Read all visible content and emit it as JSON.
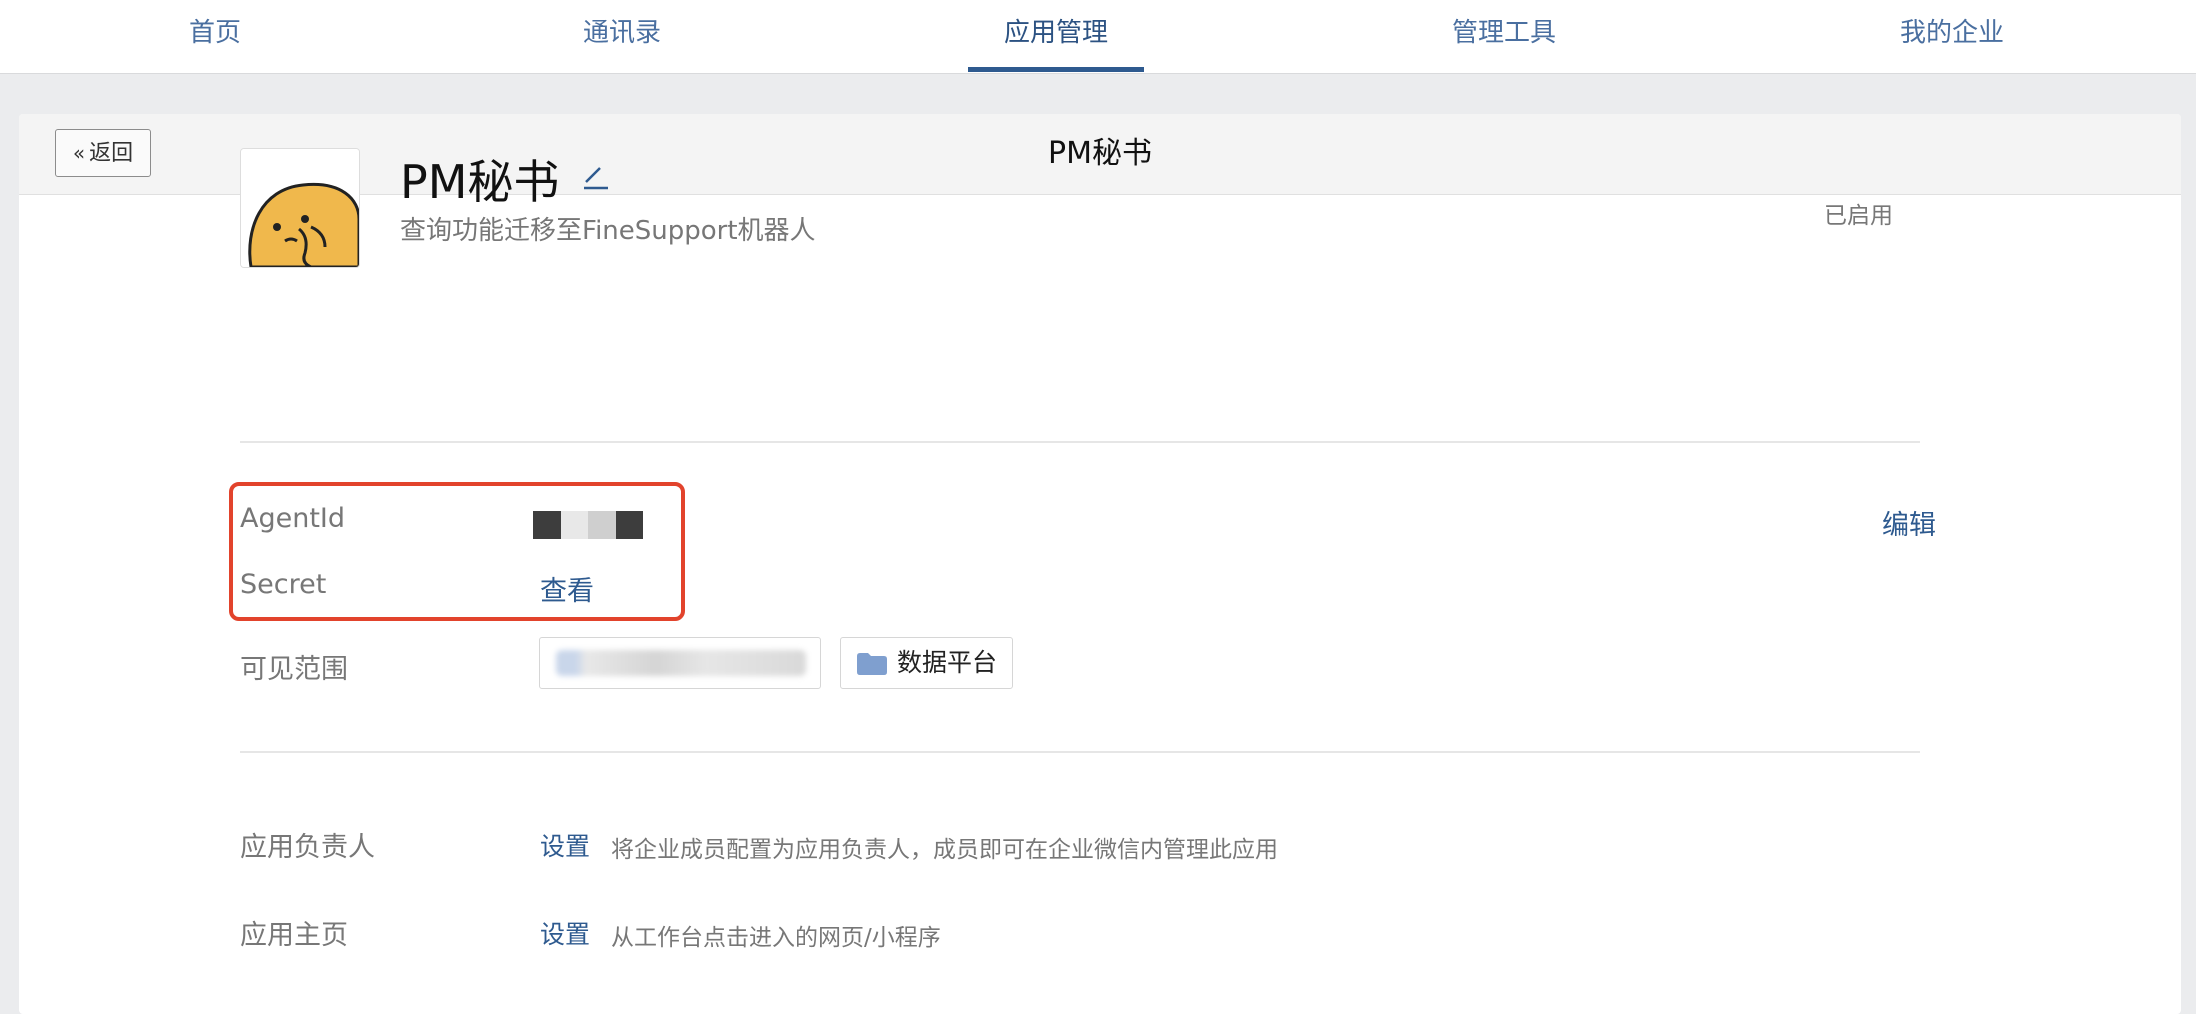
{
  "nav": {
    "items": [
      "首页",
      "通讯录",
      "应用管理",
      "管理工具",
      "我的企业"
    ],
    "active_index": 2
  },
  "header": {
    "back_label": "返回",
    "title": "PM秘书"
  },
  "app": {
    "name": "PM秘书",
    "description": "查询功能迁移至FineSupport机器人",
    "status": "已启用"
  },
  "credentials": {
    "agentid_label": "AgentId",
    "secret_label": "Secret",
    "secret_action": "查看",
    "edit_label": "编辑"
  },
  "visibility": {
    "label": "可见范围",
    "department": "数据平台"
  },
  "owner": {
    "label": "应用负责人",
    "action": "设置",
    "hint": "将企业成员配置为应用负责人，成员即可在企业微信内管理此应用"
  },
  "homepage": {
    "label": "应用主页",
    "action": "设置",
    "hint": "从工作台点击进入的网页/小程序"
  },
  "colors": {
    "accent": "#2e5a8f",
    "highlight_box": "#e2432c"
  }
}
